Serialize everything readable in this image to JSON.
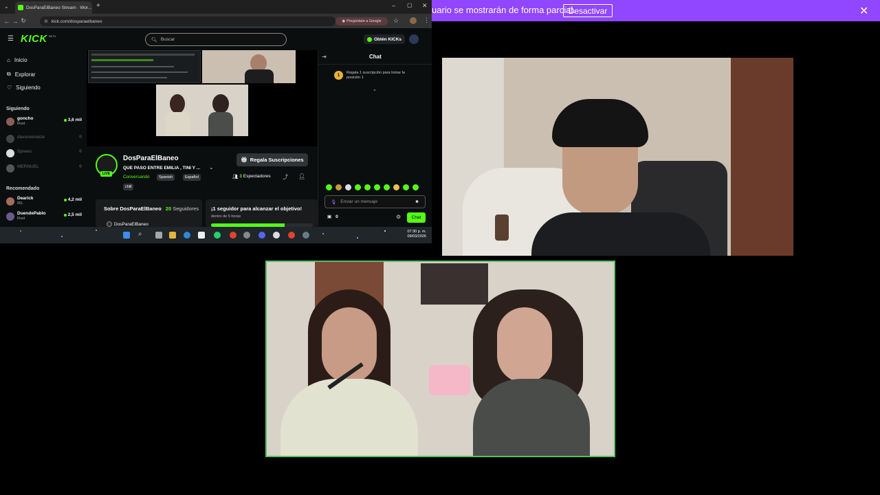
{
  "browser": {
    "tab_title": "DosParaElBaneo Stream · Wor...",
    "url": "kick.com/dosparaelbaneo",
    "google_chip": "Pregúntale a Google"
  },
  "kick": {
    "logo": "KICK",
    "logo_badge": "BETA",
    "search_placeholder": "Buscar",
    "get_kicks_label": "Obtén KICKs",
    "nav": [
      {
        "label": "Inicio",
        "icon": "home-icon"
      },
      {
        "label": "Explorar",
        "icon": "compass-icon"
      },
      {
        "label": "Siguiendo",
        "icon": "heart-icon"
      }
    ],
    "following_heading": "Siguiendo",
    "following": [
      {
        "name": "goncho",
        "category": "Rust",
        "viewers": "3,6 mil",
        "live": true
      },
      {
        "name": "davooxeneize",
        "category": "",
        "viewers": "",
        "live": false
      },
      {
        "name": "Spreen",
        "category": "",
        "viewers": "",
        "live": false
      },
      {
        "name": "MERNUEL",
        "category": "",
        "viewers": "",
        "live": false
      }
    ],
    "recommended_heading": "Recomendado",
    "recommended": [
      {
        "name": "Dearick",
        "category": "IRL",
        "viewers": "4,2 mil"
      },
      {
        "name": "DuendePablo",
        "category": "Rust",
        "viewers": "2,5 mil"
      }
    ],
    "channel": {
      "name": "DosParaElBaneo",
      "title": "QUE PASO ENTRE EMILIA , TINI Y ...",
      "live_badge": "LIVE",
      "category": "Conversando",
      "tags": [
        "Spanish",
        "Español",
        "chill"
      ],
      "viewers_count": "3",
      "viewers_label": "Espectadores",
      "gift_button": "Regala Suscripciones",
      "about_label": "Sobre DosParaElBaneo",
      "followers_count": "20",
      "followers_label": "Seguidores",
      "about_owner": "DosParaElBaneo",
      "goal_title": "¡1 seguidor para alcanzar el objetivo!",
      "goal_subtitle": "dentro de 5 horas"
    },
    "chat": {
      "header": "Chat",
      "gift_promo": "Regala 1 suscripción para tomar la posición 1",
      "promo_rank": "1",
      "input_placeholder": "Enviar un mensaje",
      "points": "0",
      "send_button": "Chat"
    }
  },
  "taskbar": {
    "time": "07:30 p. m.",
    "date": "09/03/2026"
  },
  "banner": {
    "text": "uario se mostrarán de forma parcial.",
    "button": "Desactivar"
  },
  "colors": {
    "kick_green": "#53fc18",
    "banner_purple": "#9146ff",
    "tile_border": "#53c263"
  }
}
